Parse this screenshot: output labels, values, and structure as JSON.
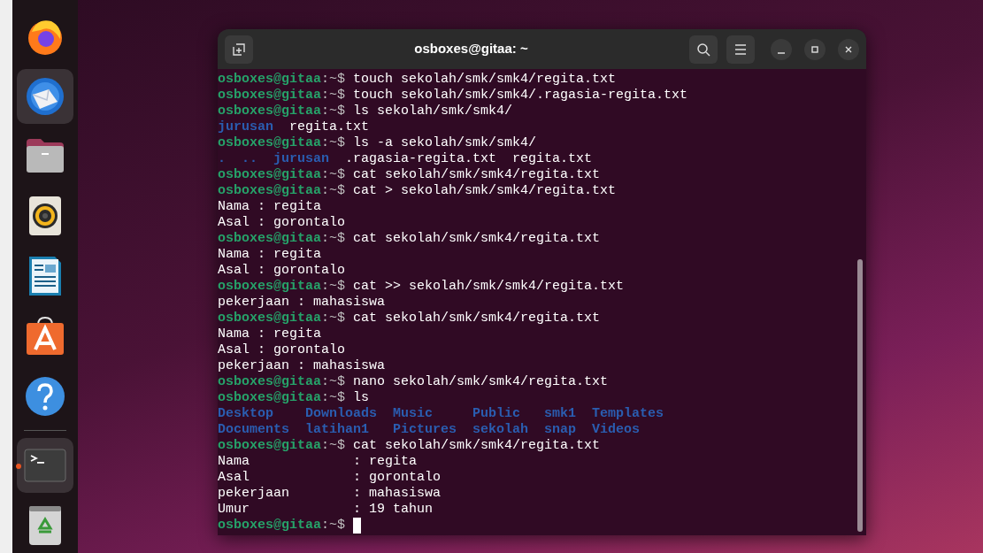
{
  "dock": {
    "items": [
      {
        "kind": "browser",
        "highlighted": false,
        "running": false
      },
      {
        "kind": "mail",
        "highlighted": true,
        "running": false
      },
      {
        "kind": "files",
        "highlighted": false,
        "running": false
      },
      {
        "kind": "music",
        "highlighted": false,
        "running": false
      },
      {
        "kind": "writer",
        "highlighted": false,
        "running": false
      },
      {
        "kind": "store",
        "highlighted": false,
        "running": false
      },
      {
        "kind": "help",
        "highlighted": false,
        "running": false
      },
      {
        "kind": "separator"
      },
      {
        "kind": "terminal",
        "highlighted": true,
        "running": true
      },
      {
        "kind": "trash",
        "highlighted": false,
        "running": false
      }
    ]
  },
  "terminal": {
    "title": "osboxes@gitaa: ~",
    "lines": [
      {
        "kind": "prompt",
        "user": "osboxes@gitaa",
        "path": ":~$",
        "command": "touch sekolah/smk/smk4/regita.txt"
      },
      {
        "kind": "prompt",
        "user": "osboxes@gitaa",
        "path": ":~$",
        "command": "touch sekolah/smk/smk4/.ragasia-regita.txt"
      },
      {
        "kind": "prompt",
        "user": "osboxes@gitaa",
        "path": ":~$",
        "command": "ls sekolah/smk/smk4/"
      },
      {
        "kind": "listing",
        "rows": [
          [
            {
              "text": "jurusan",
              "kind": "dir"
            },
            {
              "text": "regita.txt",
              "kind": "file"
            }
          ]
        ]
      },
      {
        "kind": "prompt",
        "user": "osboxes@gitaa",
        "path": ":~$",
        "command": "ls -a sekolah/smk/smk4/"
      },
      {
        "kind": "listing",
        "rows": [
          [
            {
              "text": ".",
              "kind": "dir"
            },
            {
              "text": "..",
              "kind": "dir"
            },
            {
              "text": "jurusan",
              "kind": "dir"
            },
            {
              "text": ".ragasia-regita.txt",
              "kind": "file"
            },
            {
              "text": "regita.txt",
              "kind": "file"
            }
          ]
        ]
      },
      {
        "kind": "prompt",
        "user": "osboxes@gitaa",
        "path": ":~$",
        "command": "cat sekolah/smk/smk4/regita.txt"
      },
      {
        "kind": "prompt",
        "user": "osboxes@gitaa",
        "path": ":~$",
        "command": "cat > sekolah/smk/smk4/regita.txt"
      },
      {
        "kind": "output",
        "text": "Nama : regita"
      },
      {
        "kind": "output",
        "text": "Asal : gorontalo"
      },
      {
        "kind": "prompt",
        "user": "osboxes@gitaa",
        "path": ":~$",
        "command": "cat sekolah/smk/smk4/regita.txt"
      },
      {
        "kind": "output",
        "text": "Nama : regita"
      },
      {
        "kind": "output",
        "text": "Asal : gorontalo"
      },
      {
        "kind": "prompt",
        "user": "osboxes@gitaa",
        "path": ":~$",
        "command": "cat >> sekolah/smk/smk4/regita.txt"
      },
      {
        "kind": "output",
        "text": "pekerjaan : mahasiswa"
      },
      {
        "kind": "prompt",
        "user": "osboxes@gitaa",
        "path": ":~$",
        "command": "cat sekolah/smk/smk4/regita.txt"
      },
      {
        "kind": "output",
        "text": "Nama : regita"
      },
      {
        "kind": "output",
        "text": "Asal : gorontalo"
      },
      {
        "kind": "output",
        "text": "pekerjaan : mahasiswa"
      },
      {
        "kind": "prompt",
        "user": "osboxes@gitaa",
        "path": ":~$",
        "command": "nano sekolah/smk/smk4/regita.txt"
      },
      {
        "kind": "prompt",
        "user": "osboxes@gitaa",
        "path": ":~$",
        "command": "ls"
      },
      {
        "kind": "listing",
        "rows": [
          [
            {
              "text": "Desktop",
              "kind": "dir"
            },
            {
              "text": "Downloads",
              "kind": "dir"
            },
            {
              "text": "Music",
              "kind": "dir"
            },
            {
              "text": "Public",
              "kind": "dir"
            },
            {
              "text": "smk1",
              "kind": "dir"
            },
            {
              "text": "Templates",
              "kind": "dir"
            }
          ],
          [
            {
              "text": "Documents",
              "kind": "dir"
            },
            {
              "text": "latihan1",
              "kind": "dir"
            },
            {
              "text": "Pictures",
              "kind": "dir"
            },
            {
              "text": "sekolah",
              "kind": "dir"
            },
            {
              "text": "snap",
              "kind": "dir"
            },
            {
              "text": "Videos",
              "kind": "dir"
            }
          ]
        ]
      },
      {
        "kind": "prompt",
        "user": "osboxes@gitaa",
        "path": ":~$",
        "command": "cat sekolah/smk/smk4/regita.txt"
      },
      {
        "kind": "output",
        "text": "Nama             : regita"
      },
      {
        "kind": "output",
        "text": "Asal             : gorontalo"
      },
      {
        "kind": "output",
        "text": "pekerjaan        : mahasiswa"
      },
      {
        "kind": "output",
        "text": "Umur             : 19 tahun"
      },
      {
        "kind": "prompt",
        "user": "osboxes@gitaa",
        "path": ":~$",
        "cursor": true
      }
    ]
  }
}
